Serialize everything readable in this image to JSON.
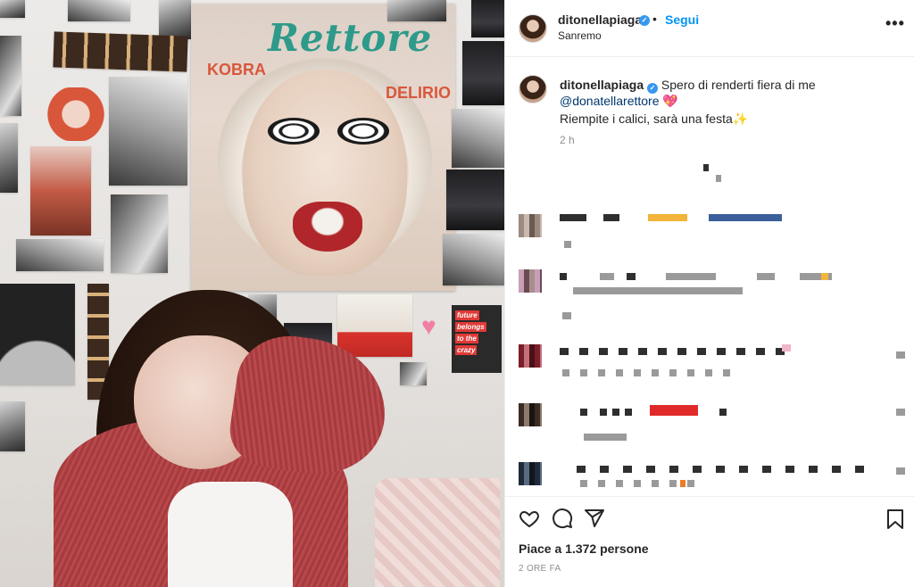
{
  "post": {
    "username": "ditonellapiaga",
    "verified_mark": "✓",
    "separator": "•",
    "follow_label": "Segui",
    "location": "Sanremo",
    "more_label": "•••",
    "caption_text": "Spero di renderti fiera di me",
    "caption_mention": "@donatellarettore",
    "caption_emoji_heart": "💖",
    "caption_line2": "Riempite i calici, sarà una festa",
    "caption_emoji_sparkles": "✨",
    "caption_time": "2 h",
    "likes_text": "Piace a 1.372 persone",
    "post_time": "2 ORE FA"
  },
  "photo": {
    "poster_title": "Rettore",
    "poster_left": "KOBRA",
    "poster_right": "DELIRIO",
    "future_sign": [
      "future",
      "belongs",
      "to the",
      "crazy"
    ]
  },
  "icons": {
    "like": "heart-outline-icon",
    "comment": "speech-bubble-icon",
    "share": "paper-plane-icon",
    "save": "bookmark-icon",
    "more": "ellipsis-icon",
    "verified": "verified-badge-icon"
  },
  "colors": {
    "accent": "#0095f6",
    "verified": "#3897f0",
    "text": "#262626",
    "muted": "#8e8e8e",
    "mention": "#00376b"
  }
}
